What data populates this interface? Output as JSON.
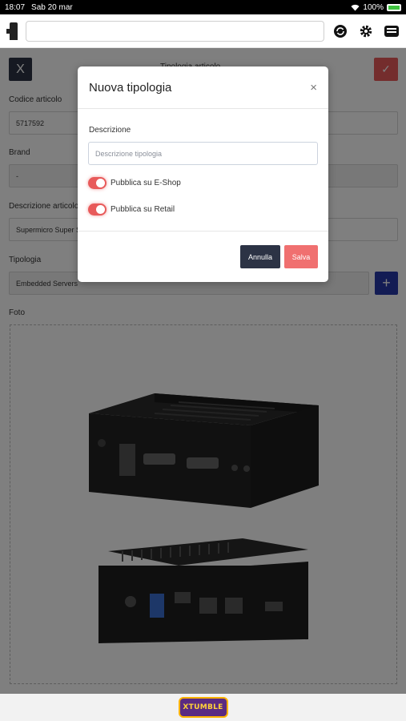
{
  "status_bar": {
    "time": "18:07",
    "date": "Sab 20 mar",
    "battery": "100%"
  },
  "page": {
    "title": "Tipologia articolo",
    "back_icon": "X",
    "save_icon": "✓",
    "fields": {
      "codice_label": "Codice articolo",
      "codice_value": "5717592",
      "brand_label": "Brand",
      "brand_value": "-",
      "descrizione_label": "Descrizione articolo",
      "descrizione_value": "Supermicro Super Server",
      "tipologia_label": "Tipologia",
      "tipologia_value": "Embedded Servers",
      "add_icon": "+",
      "foto_label": "Foto"
    }
  },
  "modal": {
    "title": "Nuova tipologia",
    "close_icon": "×",
    "descrizione_label": "Descrizione",
    "descrizione_placeholder": "Descrizione tipologia",
    "toggle_eshop_label": "Pubblica su E-Shop",
    "toggle_eshop_on": true,
    "toggle_retail_label": "Pubblica su Retail",
    "toggle_retail_on": true,
    "annulla_label": "Annulla",
    "salva_label": "Salva"
  },
  "footer": {
    "logo_text": "XTUMBLE"
  },
  "colors": {
    "accent_red": "#e85a5a",
    "dark": "#2c3345",
    "blue": "#2738a8"
  }
}
